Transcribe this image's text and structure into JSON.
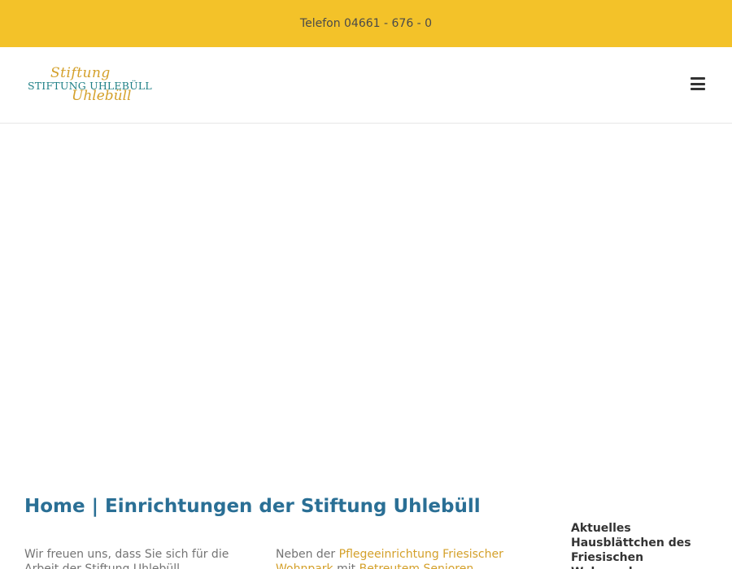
{
  "topbar": {
    "phone": "Telefon 04661 - 676 - 0",
    "background": "#f3c229"
  },
  "header": {
    "logo": {
      "script_top": "Stiftung",
      "caps": "STIFTUNG UHLEBÜLL",
      "script_bottom": "Uhlebüll",
      "colors": {
        "script": "#d4a02a",
        "caps": "#1e7f86"
      }
    },
    "menu_icon": "hamburger-icon"
  },
  "content": {
    "title": "Home | Einrichtungen der Stiftung Uhlebüll",
    "col1_text": "Wir freuen uns, dass Sie sich für die Arbeit der Stiftung Uhlebüll",
    "col2": {
      "prefix": "Neben der",
      "link1": "Pflegeeinrichtung Friesischer Wohnpark",
      "middle": "mit",
      "link2": "Betreutem Senioren"
    },
    "sidebar_heading": "Aktuelles Hausblättchen des Friesischen Wohnparks"
  },
  "colors": {
    "title": "#2a6f95",
    "link": "#d4a02a",
    "text": "#747474"
  }
}
